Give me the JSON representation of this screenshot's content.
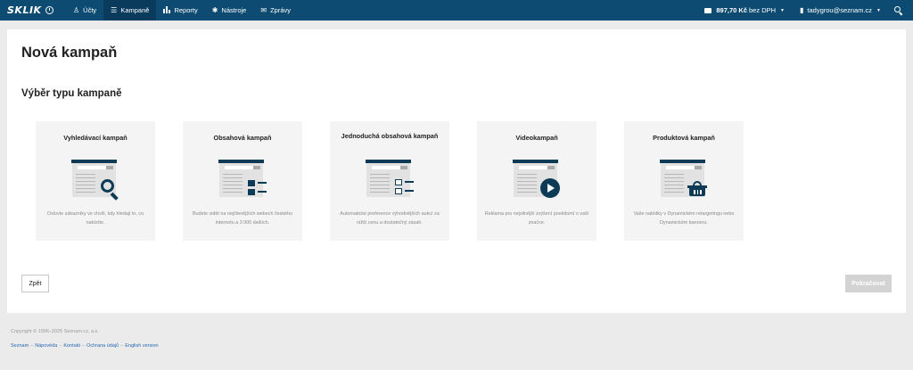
{
  "header": {
    "logo": "SKLIK",
    "nav": [
      {
        "icon": "accounts-icon",
        "glyph": "♙",
        "label": "Účty",
        "active": false
      },
      {
        "icon": "campaigns-icon",
        "glyph": "☰",
        "label": "Kampaně",
        "active": true
      },
      {
        "icon": "reports-icon",
        "glyph": "▮",
        "label": "Reporty",
        "active": false
      },
      {
        "icon": "tools-icon",
        "glyph": "✱",
        "label": "Nástroje",
        "active": false
      },
      {
        "icon": "messages-icon",
        "glyph": "✉",
        "label": "Zprávy",
        "active": false
      }
    ],
    "credit": {
      "amount": "897,70 Kč",
      "suffix": "bez DPH"
    },
    "user": {
      "email": "tadygrou@seznam.cz"
    }
  },
  "main": {
    "title": "Nová kampaň",
    "section_title": "Výběr typu kampaně",
    "cards": [
      {
        "title": "Vyhledávací kampaň",
        "description": "Oslovte zákazníky ve chvíli, kdy hledají to, co nabízíte."
      },
      {
        "title": "Obsahová kampaň",
        "description": "Budete vidět na nejčtenějších webech českého internetu a 3 000 dalších."
      },
      {
        "title": "Jednoduchá obsahová kampaň",
        "description": "Automatické preference výhodnějších aukcí za nižší cenu a dostatečný zásah."
      },
      {
        "title": "Videokampaň",
        "description": "Reklama pro nejsilnější zvýšení povědomí o vaší značce."
      },
      {
        "title": "Produktová kampaň",
        "description": "Vaše nabídky v Dynamickém retargetingu nebo Dynamickém banneru."
      }
    ],
    "back_label": "Zpět",
    "continue_label": "Pokračovat"
  },
  "footer": {
    "copyright": "Copyright © 1996–2025 Seznam.cz, a.s.",
    "links": [
      "Seznam",
      "Nápověda",
      "Kontakt",
      "Ochrana údajů",
      "English version"
    ]
  }
}
